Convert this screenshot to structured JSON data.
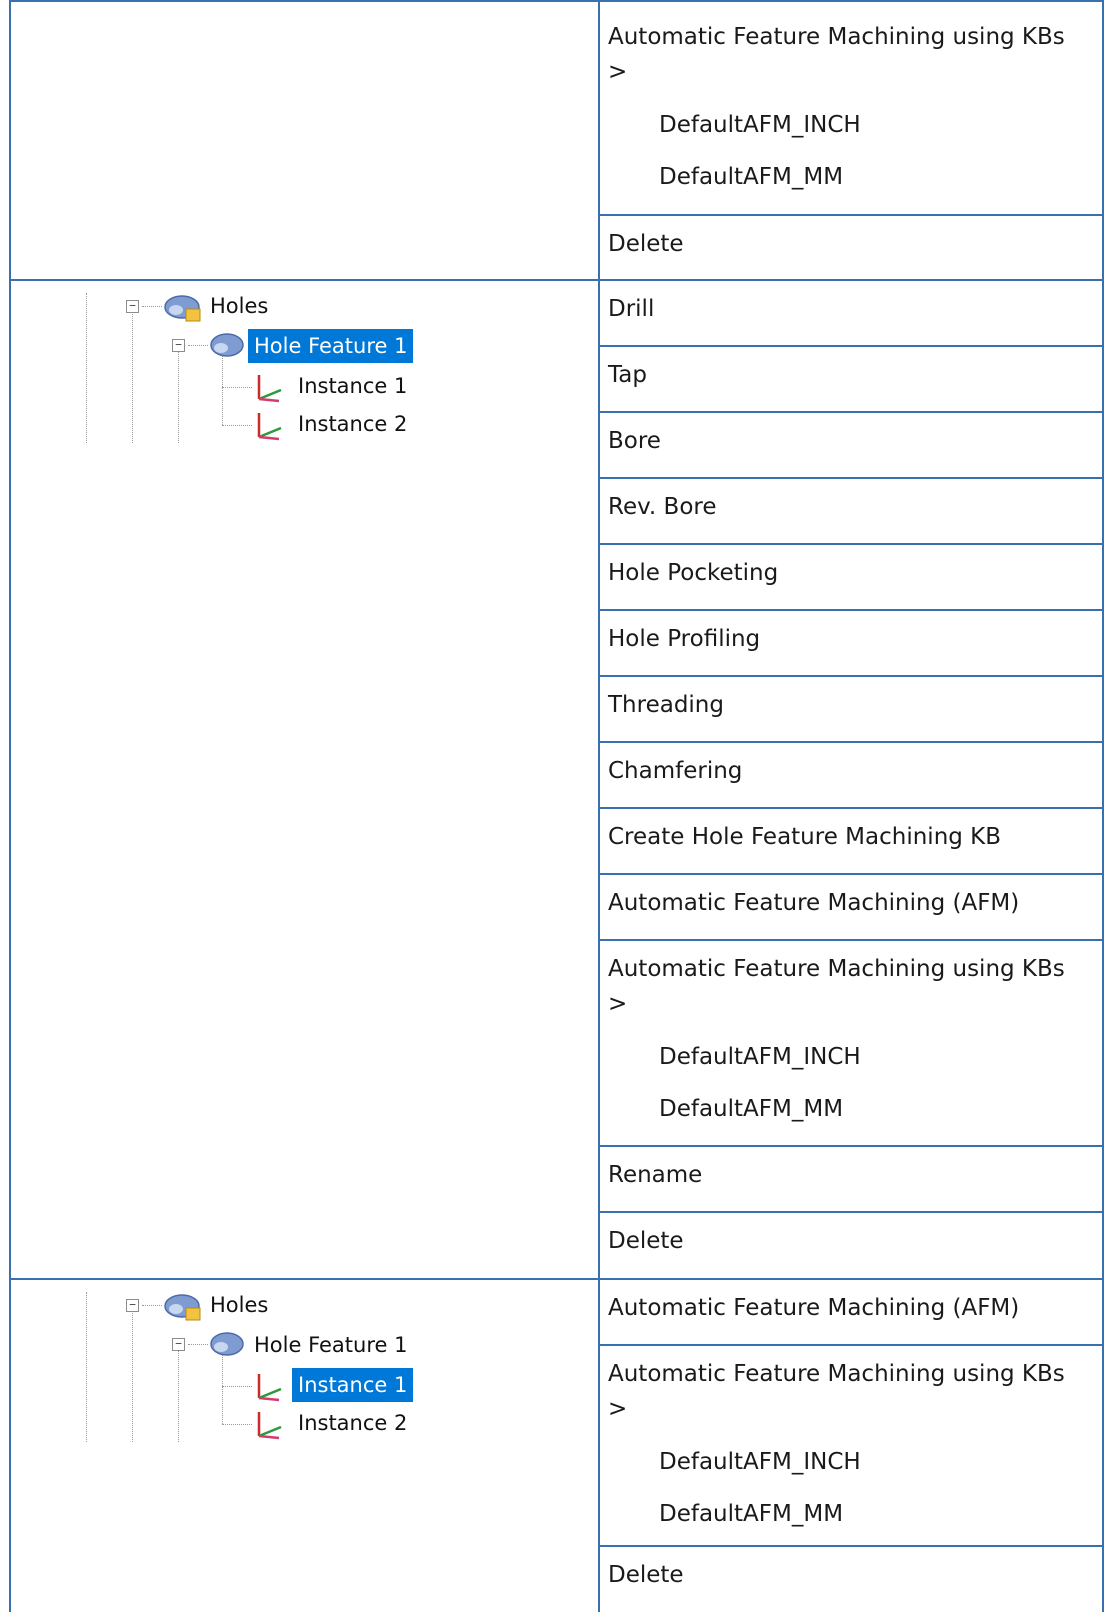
{
  "sections": [
    {
      "items": [
        {
          "label": "Automatic Feature Machining using KBs",
          "suffix": ">",
          "subitems": [
            "DefaultAFM_INCH",
            "DefaultAFM_MM"
          ]
        },
        {
          "label": "Delete"
        }
      ]
    },
    {
      "tree": {
        "root": "Holes",
        "feature": "Hole Feature 1",
        "instances": [
          "Instance 1",
          "Instance 2"
        ],
        "selected": "Hole Feature 1"
      },
      "items": [
        {
          "label": "Drill"
        },
        {
          "label": "Tap"
        },
        {
          "label": "Bore"
        },
        {
          "label": "Rev. Bore"
        },
        {
          "label": "Hole Pocketing"
        },
        {
          "label": "Hole Profiling"
        },
        {
          "label": "Threading"
        },
        {
          "label": "Chamfering"
        },
        {
          "label": "Create Hole Feature Machining KB"
        },
        {
          "label": "Automatic Feature Machining (AFM)"
        },
        {
          "label": "Automatic Feature Machining using KBs",
          "suffix": ">",
          "subitems": [
            "DefaultAFM_INCH",
            "DefaultAFM_MM"
          ]
        },
        {
          "label": "Rename"
        },
        {
          "label": "Delete"
        }
      ]
    },
    {
      "tree": {
        "root": "Holes",
        "feature": "Hole Feature 1",
        "instances": [
          "Instance 1",
          "Instance 2"
        ],
        "selected": "Instance 1"
      },
      "items": [
        {
          "label": "Automatic Feature Machining (AFM)"
        },
        {
          "label": "Automatic Feature Machining using KBs",
          "suffix": ">",
          "subitems": [
            "DefaultAFM_INCH",
            "DefaultAFM_MM"
          ]
        },
        {
          "label": "Delete"
        }
      ]
    }
  ],
  "colors": {
    "border": "#3a6fb0",
    "selection": "#0078d7"
  }
}
